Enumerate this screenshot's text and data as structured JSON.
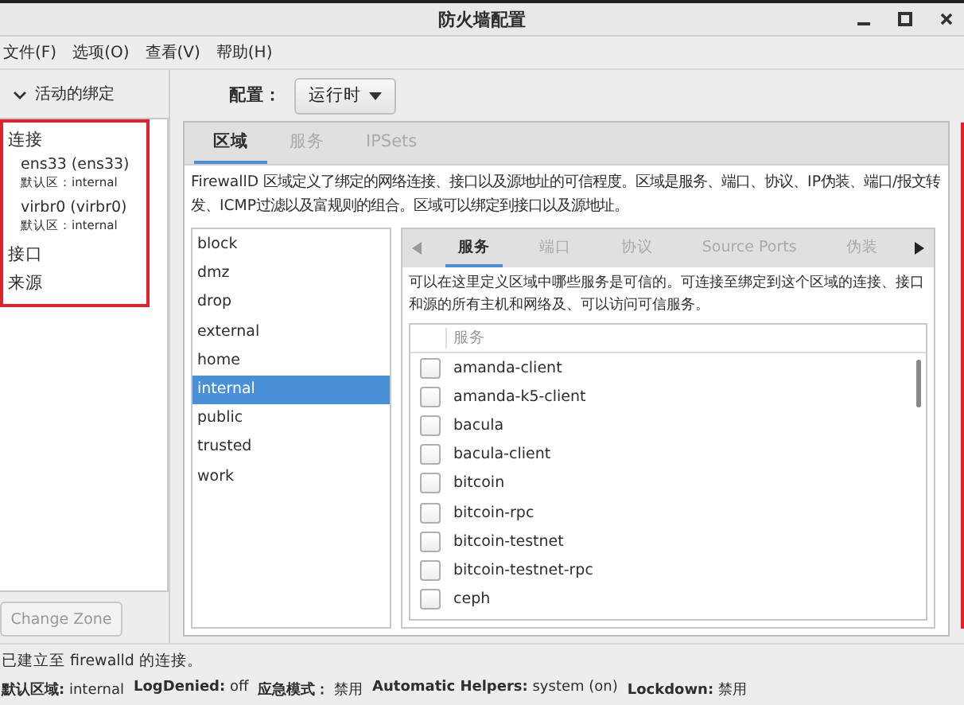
{
  "window": {
    "title": "防火墙配置"
  },
  "menu": [
    "文件(F)",
    "选项(O)",
    "查看(V)",
    "帮助(H)"
  ],
  "bindings": {
    "header": "活动的绑定",
    "expanded": true,
    "sections": [
      {
        "title": "连接",
        "children": [
          {
            "name": "ens33 (ens33)",
            "zone": "默认区：internal"
          },
          {
            "name": "virbr0 (virbr0)",
            "zone": "默认区：internal"
          }
        ]
      },
      {
        "title": "接口"
      },
      {
        "title": "来源"
      }
    ],
    "button": "Change Zone",
    "button_disabled": true
  },
  "config": {
    "label": "配置：",
    "value": "运行时"
  },
  "tabs": [
    {
      "label": "区域",
      "selected": true
    },
    {
      "label": "服务",
      "selected": false
    },
    {
      "label": "IPSets",
      "selected": false
    }
  ],
  "zone_description": "FirewallD 区域定义了绑定的网络连接、接口以及源地址的可信程度。区域是服务、端口、协议、IP伪装、端口/报文转发、ICMP过滤以及富规则的组合。区域可以绑定到接口以及源地址。",
  "zones": [
    {
      "name": "block",
      "selected": false
    },
    {
      "name": "dmz",
      "selected": false
    },
    {
      "name": "drop",
      "selected": false
    },
    {
      "name": "external",
      "selected": false
    },
    {
      "name": "home",
      "selected": false
    },
    {
      "name": "internal",
      "selected": true
    },
    {
      "name": "public",
      "selected": false
    },
    {
      "name": "trusted",
      "selected": false
    },
    {
      "name": "work",
      "selected": false
    }
  ],
  "zone_tabs": [
    {
      "label": "服务",
      "selected": true
    },
    {
      "label": "端口",
      "selected": false
    },
    {
      "label": "协议",
      "selected": false
    },
    {
      "label": "Source Ports",
      "selected": false
    },
    {
      "label": "伪装",
      "selected": false
    }
  ],
  "services_description": "可以在这里定义区域中哪些服务是可信的。可连接至绑定到这个区域的连接、接口和源的所有主机和网络及、可以访问可信服务。",
  "services_table": {
    "column": "服务",
    "rows": [
      {
        "name": "amanda-client",
        "checked": false
      },
      {
        "name": "amanda-k5-client",
        "checked": false
      },
      {
        "name": "bacula",
        "checked": false
      },
      {
        "name": "bacula-client",
        "checked": false
      },
      {
        "name": "bitcoin",
        "checked": false
      },
      {
        "name": "bitcoin-rpc",
        "checked": false
      },
      {
        "name": "bitcoin-testnet",
        "checked": false
      },
      {
        "name": "bitcoin-testnet-rpc",
        "checked": false
      },
      {
        "name": "ceph",
        "checked": false
      }
    ]
  },
  "status_bar": {
    "message": "已建立至 firewalld 的连接。",
    "items": [
      {
        "label": "默认区域:",
        "value": "internal"
      },
      {
        "label": "LogDenied:",
        "value": "off"
      },
      {
        "label": "应急模式：",
        "value": "禁用"
      },
      {
        "label": "Automatic Helpers:",
        "value": "system (on)"
      },
      {
        "label": "Lockdown:",
        "value": "禁用"
      }
    ]
  }
}
